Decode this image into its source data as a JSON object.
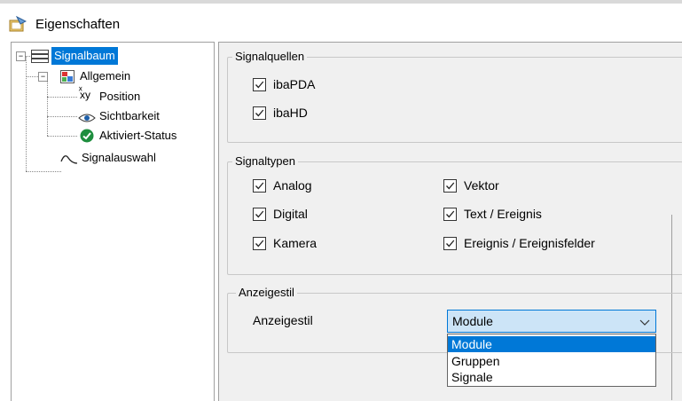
{
  "window": {
    "title": "Eigenschaften"
  },
  "tree": {
    "root": {
      "label": "Signalbaum",
      "expander": "−"
    },
    "general": {
      "label": "Allgemein",
      "expander": "−"
    },
    "position": {
      "label": "Position"
    },
    "visibility": {
      "label": "Sichtbarkeit"
    },
    "active": {
      "label": "Aktiviert-Status"
    },
    "selection": {
      "label": "Signalauswahl"
    }
  },
  "groups": {
    "sources": {
      "title": "Signalquellen",
      "items": [
        {
          "label": "ibaPDA",
          "checked": true
        },
        {
          "label": "ibaHD",
          "checked": true
        }
      ]
    },
    "types": {
      "title": "Signaltypen",
      "items": [
        {
          "label": "Analog",
          "checked": true
        },
        {
          "label": "Digital",
          "checked": true
        },
        {
          "label": "Kamera",
          "checked": true
        },
        {
          "label": "Vektor",
          "checked": true
        },
        {
          "label": "Text / Ereignis",
          "checked": true
        },
        {
          "label": "Ereignis / Ereignisfelder",
          "checked": true
        }
      ]
    },
    "style": {
      "title": "Anzeigestil",
      "field_label": "Anzeigestil",
      "selected": "Module",
      "options": [
        "Module",
        "Gruppen",
        "Signale"
      ]
    }
  },
  "colors": {
    "selection": "#0078d7",
    "combo_bg": "#cce4f7",
    "panel_bg": "#f0f0f0"
  }
}
